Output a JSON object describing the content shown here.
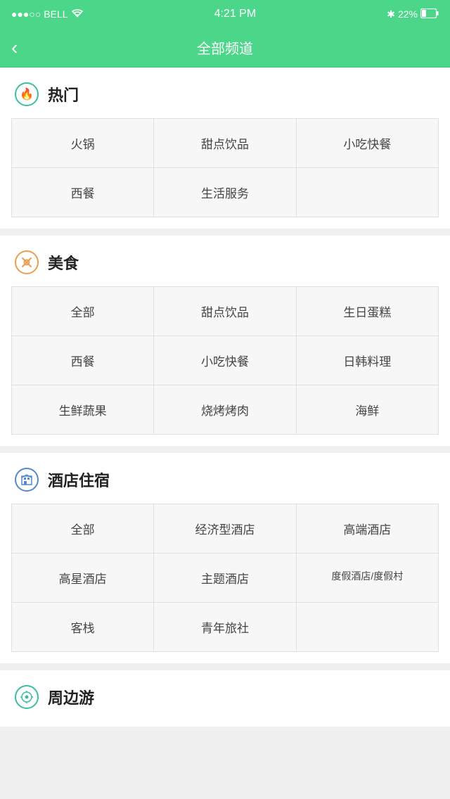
{
  "statusBar": {
    "signal": "●●●○○",
    "carrier": "BELL",
    "time": "4:21 PM",
    "bluetooth": "B",
    "battery": "22%"
  },
  "navBar": {
    "back": "‹",
    "title": "全部频道"
  },
  "sections": [
    {
      "id": "hot",
      "title": "热门",
      "icon": "hot-icon",
      "items": [
        [
          "火锅",
          "甜点饮品",
          "小吃快餐"
        ],
        [
          "西餐",
          "生活服务",
          ""
        ]
      ]
    },
    {
      "id": "food",
      "title": "美食",
      "icon": "food-icon",
      "items": [
        [
          "全部",
          "甜点饮品",
          "生日蛋糕"
        ],
        [
          "西餐",
          "小吃快餐",
          "日韩料理"
        ],
        [
          "生鲜蔬果",
          "烧烤烤肉",
          "海鲜"
        ]
      ]
    },
    {
      "id": "hotel",
      "title": "酒店住宿",
      "icon": "hotel-icon",
      "items": [
        [
          "全部",
          "经济型酒店",
          "高端酒店"
        ],
        [
          "高星酒店",
          "主题酒店",
          "度假酒店/度假村"
        ],
        [
          "客栈",
          "青年旅社",
          ""
        ]
      ]
    },
    {
      "id": "nearby",
      "title": "周边游",
      "icon": "nearby-icon",
      "items": []
    }
  ]
}
